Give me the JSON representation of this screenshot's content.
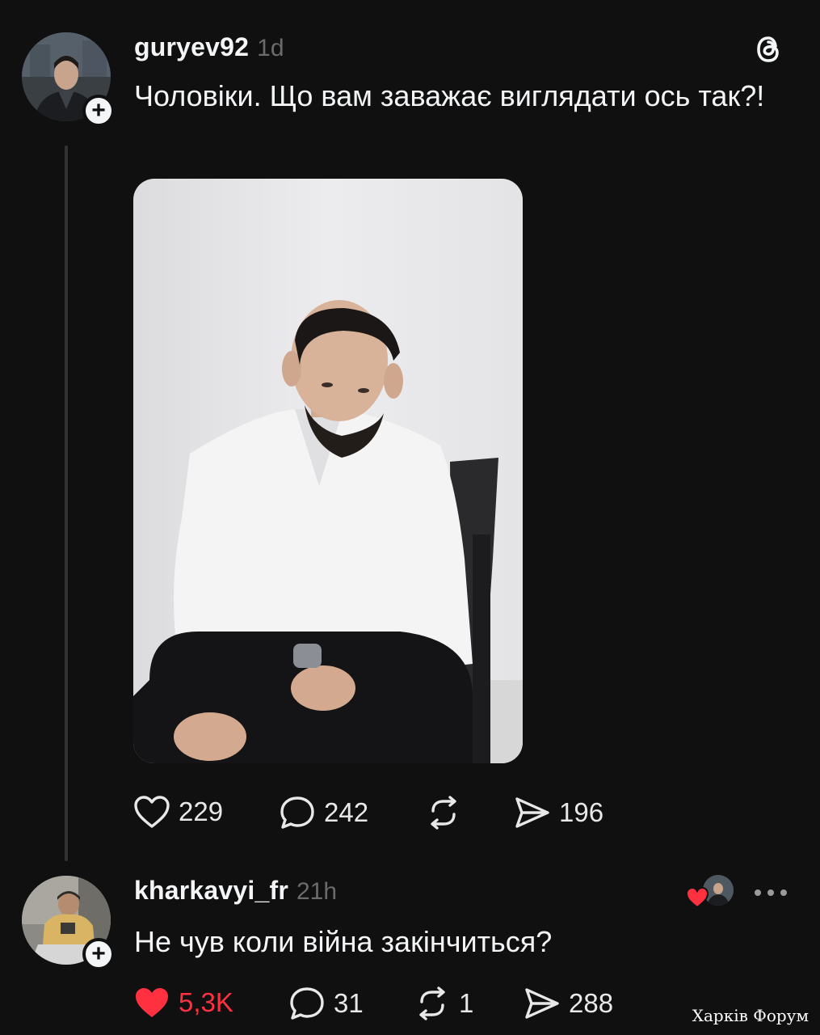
{
  "post": {
    "username": "guryev92",
    "time": "1d",
    "text": "Чоловіки. Що вам заважає виглядати ось так?!",
    "icon": "threads-logo-icon",
    "actions": {
      "likes": "229",
      "comments": "242",
      "reposts": "",
      "shares": "196"
    }
  },
  "reply": {
    "username": "kharkavyi_fr",
    "time": "21h",
    "text": "Не чув коли війна закінчиться?",
    "actions": {
      "likes": "5,3K",
      "comments": "31",
      "reposts": "1",
      "shares": "288"
    }
  },
  "watermark": "Харків Форум",
  "colors": {
    "background": "#101010",
    "text": "#f3f5f7",
    "muted": "#6b6b6b",
    "like_red": "#ff3040"
  }
}
